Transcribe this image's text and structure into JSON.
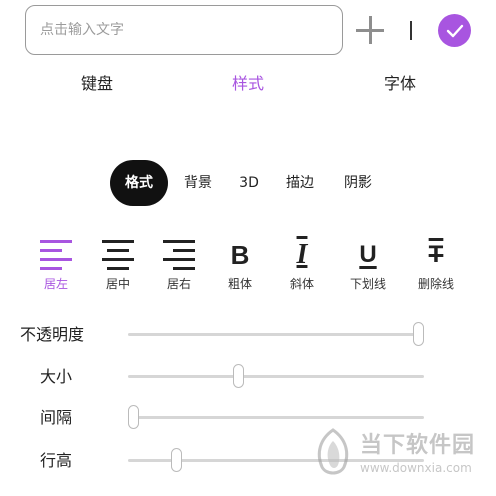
{
  "input": {
    "placeholder": "点击输入文字",
    "value": ""
  },
  "colors": {
    "accent": "#a855e0",
    "active_pill": "#111111"
  },
  "icons": {
    "add": "plus-icon",
    "caret": "text-cursor-icon",
    "confirm": "checkmark-icon"
  },
  "main_tabs": [
    {
      "label": "键盘",
      "active": false
    },
    {
      "label": "样式",
      "active": true
    },
    {
      "label": "字体",
      "active": false
    }
  ],
  "sub_tabs": [
    {
      "label": "格式",
      "active": true
    },
    {
      "label": "背景",
      "active": false
    },
    {
      "label": "3D",
      "active": false
    },
    {
      "label": "描边",
      "active": false
    },
    {
      "label": "阴影",
      "active": false
    }
  ],
  "format_options": [
    {
      "label": "居左",
      "icon": "align-left-icon",
      "active": true
    },
    {
      "label": "居中",
      "icon": "align-center-icon",
      "active": false
    },
    {
      "label": "居右",
      "icon": "align-right-icon",
      "active": false
    },
    {
      "label": "粗体",
      "icon": "bold-icon",
      "glyph": "B",
      "active": false
    },
    {
      "label": "斜体",
      "icon": "italic-icon",
      "glyph": "I",
      "active": false
    },
    {
      "label": "下划线",
      "icon": "underline-icon",
      "glyph": "U",
      "active": false
    },
    {
      "label": "删除线",
      "icon": "strikethrough-icon",
      "glyph": "T",
      "active": false
    }
  ],
  "sliders": [
    {
      "label": "不透明度",
      "value": 1.0
    },
    {
      "label": "大小",
      "value": 0.37
    },
    {
      "label": "间隔",
      "value": 0.0
    },
    {
      "label": "行高",
      "value": 0.15
    }
  ],
  "watermark": {
    "title": "当下软件园",
    "url": "www.downxia.com"
  }
}
